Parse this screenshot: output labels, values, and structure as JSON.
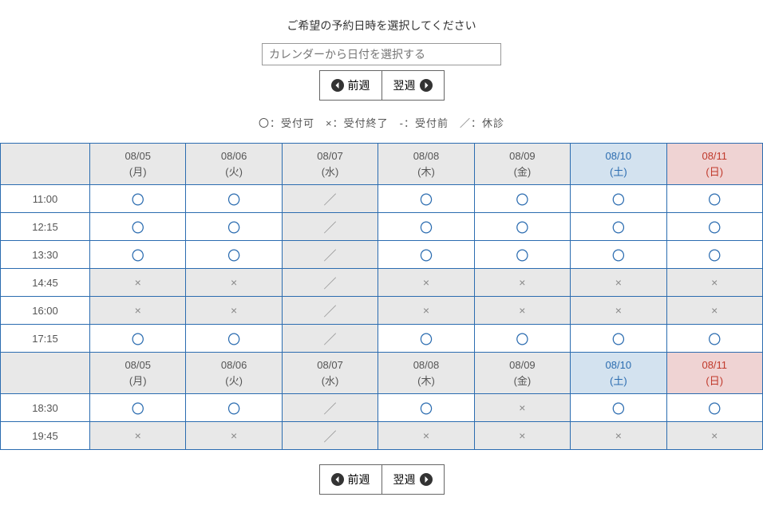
{
  "title": "ご希望の予約日時を選択してください",
  "dateSelect": {
    "placeholder": "カレンダーから日付を選択する"
  },
  "nav": {
    "prev": "前週",
    "next": "翌週"
  },
  "legend": "〇：受付可　×：受付終了　-：受付前　／：休診",
  "symbols": {
    "open": "〇",
    "closed": "×",
    "before": "-",
    "holiday": "／"
  },
  "days": [
    {
      "date": "08/05",
      "dow": "(月)",
      "type": "weekday"
    },
    {
      "date": "08/06",
      "dow": "(火)",
      "type": "weekday"
    },
    {
      "date": "08/07",
      "dow": "(水)",
      "type": "weekday"
    },
    {
      "date": "08/08",
      "dow": "(木)",
      "type": "weekday"
    },
    {
      "date": "08/09",
      "dow": "(金)",
      "type": "weekday"
    },
    {
      "date": "08/10",
      "dow": "(土)",
      "type": "sat"
    },
    {
      "date": "08/11",
      "dow": "(日)",
      "type": "sun"
    }
  ],
  "morningTimes": [
    "11:00",
    "12:15",
    "13:30",
    "14:45",
    "16:00",
    "17:15"
  ],
  "morningSlots": [
    [
      "open",
      "open",
      "holiday",
      "open",
      "open",
      "open",
      "open"
    ],
    [
      "open",
      "open",
      "holiday",
      "open",
      "open",
      "open",
      "open"
    ],
    [
      "open",
      "open",
      "holiday",
      "open",
      "open",
      "open",
      "open"
    ],
    [
      "closed",
      "closed",
      "holiday",
      "closed",
      "closed",
      "closed",
      "closed"
    ],
    [
      "closed",
      "closed",
      "holiday",
      "closed",
      "closed",
      "closed",
      "closed"
    ],
    [
      "open",
      "open",
      "holiday",
      "open",
      "open",
      "open",
      "open"
    ]
  ],
  "eveningTimes": [
    "18:30",
    "19:45"
  ],
  "eveningSlots": [
    [
      "open",
      "open",
      "holiday",
      "open",
      "closed",
      "open",
      "open"
    ],
    [
      "closed",
      "closed",
      "holiday",
      "closed",
      "closed",
      "closed",
      "closed"
    ]
  ]
}
